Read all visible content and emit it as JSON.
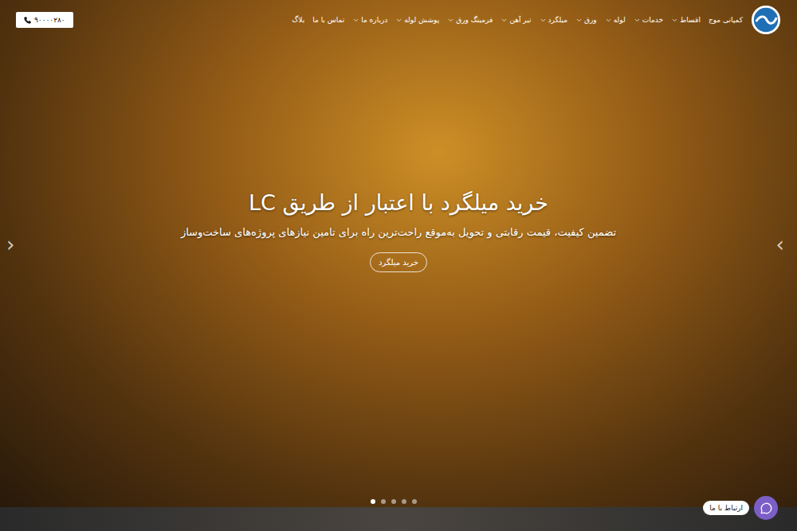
{
  "header": {
    "brand": "کمپانی موج",
    "menu": [
      {
        "label": "اقساط",
        "has_dropdown": true
      },
      {
        "label": "خدمات",
        "has_dropdown": true
      },
      {
        "label": "لوله",
        "has_dropdown": true
      },
      {
        "label": "ورق",
        "has_dropdown": true
      },
      {
        "label": "میلگرد",
        "has_dropdown": true
      },
      {
        "label": "تیر آهن",
        "has_dropdown": true
      },
      {
        "label": "فرمینگ ورق",
        "has_dropdown": true
      },
      {
        "label": "پوشش لوله",
        "has_dropdown": true
      },
      {
        "label": "درباره ما",
        "has_dropdown": true
      },
      {
        "label": "تماس با ما",
        "has_dropdown": false
      },
      {
        "label": "بلاگ",
        "has_dropdown": false
      }
    ],
    "phone": "۹۰۰۰۰۲۸۰"
  },
  "hero": {
    "title": "خرید میلگرد با اعتبار از طریق LC",
    "subtitle": "تضمین کیفیت، قیمت رقابتی و تحویل به‌موقع راحت‌ترین راه برای تامین نیازهای پروژه‌های ساخت‌وساز",
    "button": "خرید میلگرد",
    "prev": "‹",
    "next": "›",
    "dots": [
      {
        "selected": true
      },
      {
        "selected": false
      },
      {
        "selected": false
      },
      {
        "selected": false
      },
      {
        "selected": false
      }
    ]
  },
  "contact_widget": {
    "label": "ارتباط با ما"
  }
}
